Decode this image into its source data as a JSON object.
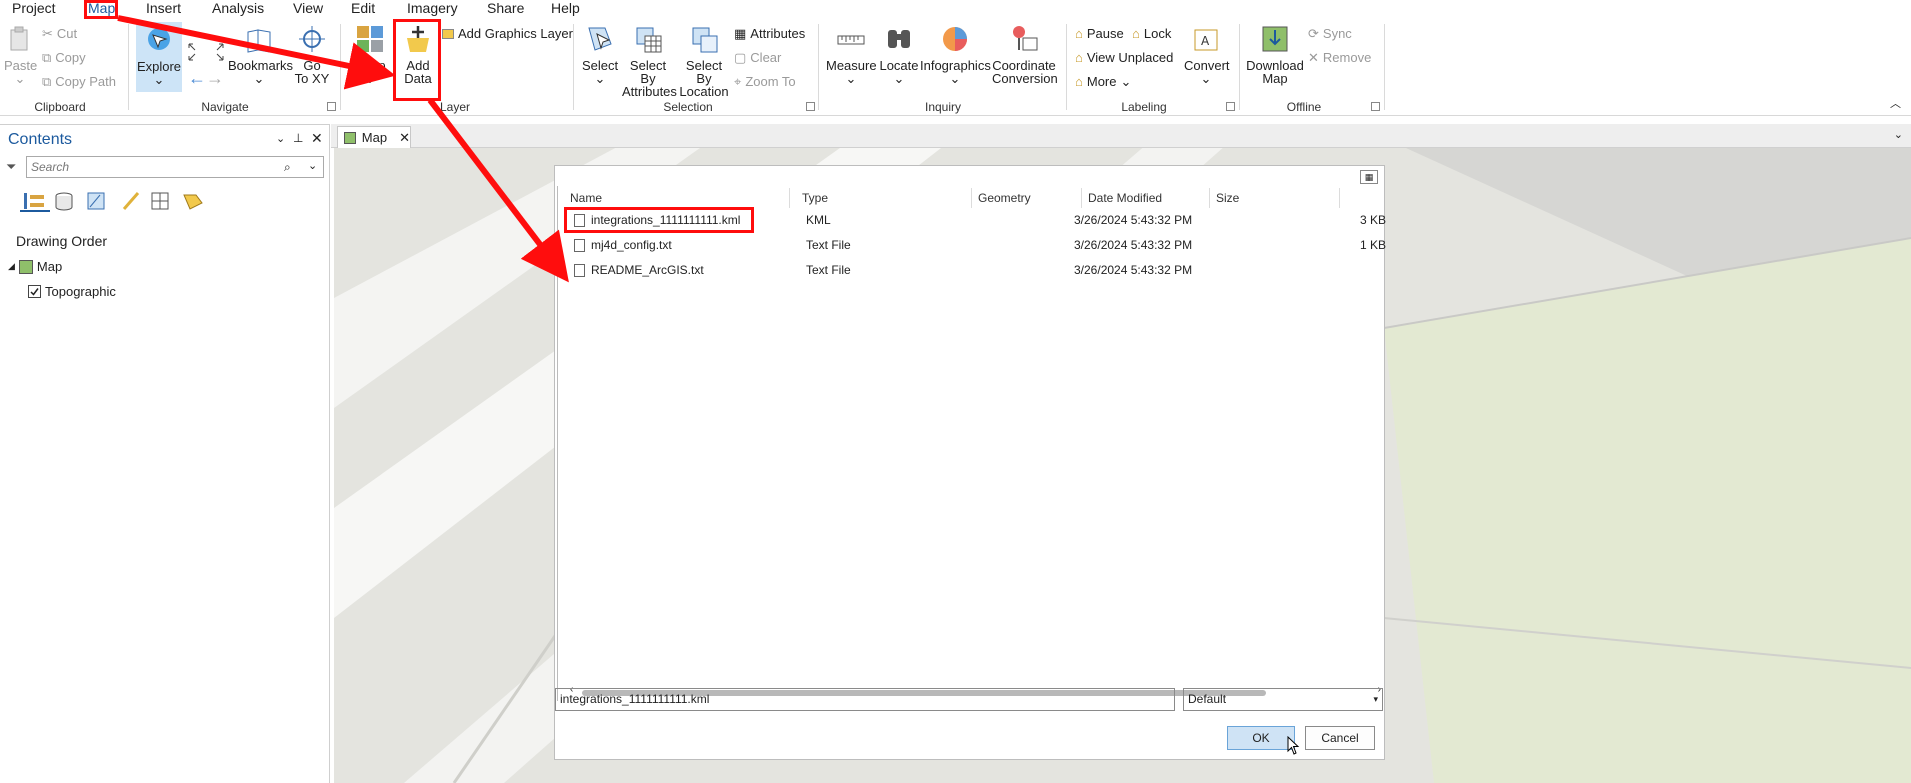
{
  "menubar": {
    "items": [
      "Project",
      "Map",
      "Insert",
      "Analysis",
      "View",
      "Edit",
      "Imagery",
      "Share",
      "Help"
    ]
  },
  "ribbon": {
    "clipboard": {
      "paste": "Paste",
      "cut": "Cut",
      "copy": "Copy",
      "copy_path": "Copy Path",
      "label": "Clipboard"
    },
    "navigate": {
      "explore": "Explore",
      "bookmarks": "Bookmarks",
      "goto_line1": "Go",
      "goto_line2": "To XY",
      "label": "Navigate"
    },
    "layer": {
      "add_data_line1": "Add",
      "add_data_line2": "Data",
      "add_graphics": "Add Graphics Layer",
      "basemap_partial": "p",
      "label": "Layer"
    },
    "selection": {
      "select": "Select",
      "by_attr_line1": "Select By",
      "by_attr_line2": "Attributes",
      "by_loc_line1": "Select By",
      "by_loc_line2": "Location",
      "attributes": "Attributes",
      "clear": "Clear",
      "zoom_to": "Zoom To",
      "label": "Selection"
    },
    "inquiry": {
      "measure": "Measure",
      "locate": "Locate",
      "infographics": "Infographics",
      "coord_line1": "Coordinate",
      "coord_line2": "Conversion",
      "label": "Inquiry"
    },
    "labeling": {
      "pause": "Pause",
      "lock": "Lock",
      "view_unplaced": "View Unplaced",
      "more": "More",
      "convert": "Convert",
      "label": "Labeling"
    },
    "offline": {
      "download_line1": "Download",
      "download_line2": "Map",
      "sync": "Sync",
      "remove": "Remove",
      "label": "Offline"
    }
  },
  "contents": {
    "title": "Contents",
    "search_placeholder": "Search",
    "drawing_order": "Drawing Order",
    "map_item": "Map",
    "layer_item": "Topographic"
  },
  "map_tab": {
    "label": "Map"
  },
  "dialog": {
    "columns": [
      "Name",
      "Type",
      "Geometry",
      "Date Modified",
      "Size"
    ],
    "rows": [
      {
        "name": "integrations_1111111111.kml",
        "type": "KML",
        "geometry": "",
        "date": "3/26/2024 5:43:32 PM",
        "size": "3 KB"
      },
      {
        "name": "mj4d_config.txt",
        "type": "Text File",
        "geometry": "",
        "date": "3/26/2024 5:43:32 PM",
        "size": "1 KB"
      },
      {
        "name": "README_ArcGIS.txt",
        "type": "Text File",
        "geometry": "",
        "date": "3/26/2024 5:43:32 PM",
        "size": ""
      }
    ],
    "filename_value": "integrations_1111111111.kml",
    "filter_value": "Default",
    "ok": "OK",
    "cancel": "Cancel"
  },
  "colors": {
    "accent": "#1c5a9e",
    "annotation": "#ff0d0d",
    "ok_bg": "#cfe3f5"
  }
}
